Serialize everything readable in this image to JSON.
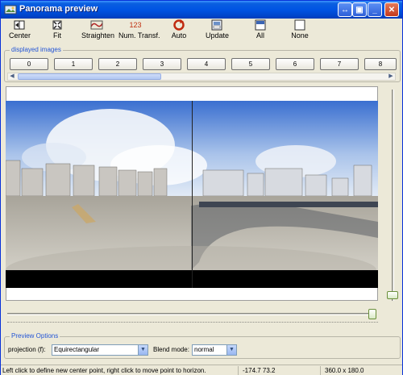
{
  "window": {
    "title": "Panorama preview"
  },
  "toolbar": {
    "center": "Center",
    "fit": "Fit",
    "straighten": "Straighten",
    "num_transf": "Num. Transf.",
    "num_transf_icon_text": "123",
    "auto": "Auto",
    "update": "Update",
    "all": "All",
    "none": "None"
  },
  "displayed_images": {
    "title": "displayed images",
    "buttons": [
      "0",
      "1",
      "2",
      "3",
      "4",
      "5",
      "6",
      "7",
      "8"
    ]
  },
  "preview_options": {
    "title": "Preview Options",
    "projection_label": "projection (f):",
    "projection_value": "Equirectangular",
    "blend_label": "Blend mode:",
    "blend_value": "normal"
  },
  "statusbar": {
    "hint": "Left click to define new center point, right click to move point to horizon.",
    "coords": "-174.7 73.2",
    "fov": "360.0 x 180.0"
  },
  "colors": {
    "titlebar": "#0054e3",
    "group_title": "#2254d6",
    "background": "#ece9d8"
  }
}
